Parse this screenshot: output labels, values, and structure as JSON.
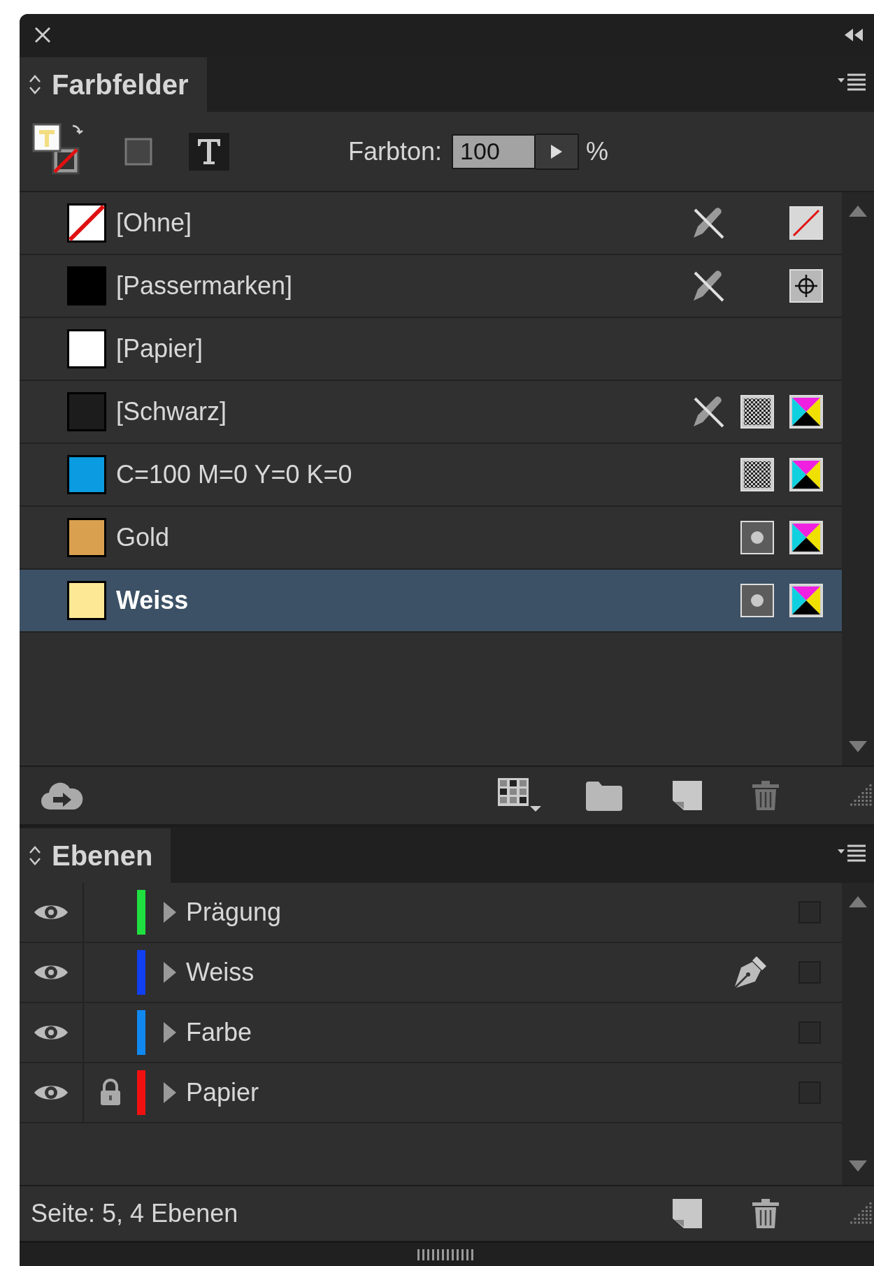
{
  "swatches_panel": {
    "title": "Farbfelder",
    "tint_label": "Farbton:",
    "tint_value": "100",
    "tint_unit": "%",
    "swatches": [
      {
        "name": "[Ohne]",
        "kind": "none",
        "no_edit": true,
        "mode_icon": {
          "kind": "none"
        },
        "selected": false
      },
      {
        "name": "[Passermarken]",
        "kind": "color",
        "color": "#000000",
        "no_edit": true,
        "mode_icon": {
          "kind": "registration"
        },
        "selected": false
      },
      {
        "name": "[Papier]",
        "kind": "color",
        "color": "#ffffff",
        "no_edit": false,
        "selected": false
      },
      {
        "name": "[Schwarz]",
        "kind": "color",
        "color": "#1c1c1c",
        "no_edit": true,
        "type_icon": {
          "kind": "process"
        },
        "mode_icon": {
          "kind": "cmyk"
        },
        "selected": false
      },
      {
        "name": "C=100 M=0 Y=0 K=0",
        "kind": "color",
        "color": "#0a9be0",
        "no_edit": false,
        "type_icon": {
          "kind": "process"
        },
        "mode_icon": {
          "kind": "cmyk"
        },
        "selected": false
      },
      {
        "name": "Gold",
        "kind": "color",
        "color": "#d9a050",
        "no_edit": false,
        "type_icon": {
          "kind": "spot"
        },
        "mode_icon": {
          "kind": "cmyk"
        },
        "selected": false
      },
      {
        "name": "Weiss",
        "kind": "color",
        "color": "#fde895",
        "no_edit": false,
        "type_icon": {
          "kind": "spot"
        },
        "mode_icon": {
          "kind": "cmyk"
        },
        "selected": true
      }
    ]
  },
  "layers_panel": {
    "title": "Ebenen",
    "status": "Seite: 5, 4 Ebenen",
    "layers": [
      {
        "name": "Prägung",
        "color": "#1fe040",
        "visible": true,
        "locked": false,
        "current": false,
        "expanded": false,
        "checked": false
      },
      {
        "name": "Weiss",
        "color": "#1040f0",
        "visible": true,
        "locked": false,
        "current": true,
        "expanded": false,
        "checked": false
      },
      {
        "name": "Farbe",
        "color": "#1088f0",
        "visible": true,
        "locked": false,
        "current": false,
        "expanded": false,
        "checked": false
      },
      {
        "name": "Papier",
        "color": "#f01010",
        "visible": true,
        "locked": true,
        "current": false,
        "expanded": false,
        "checked": false
      }
    ]
  }
}
